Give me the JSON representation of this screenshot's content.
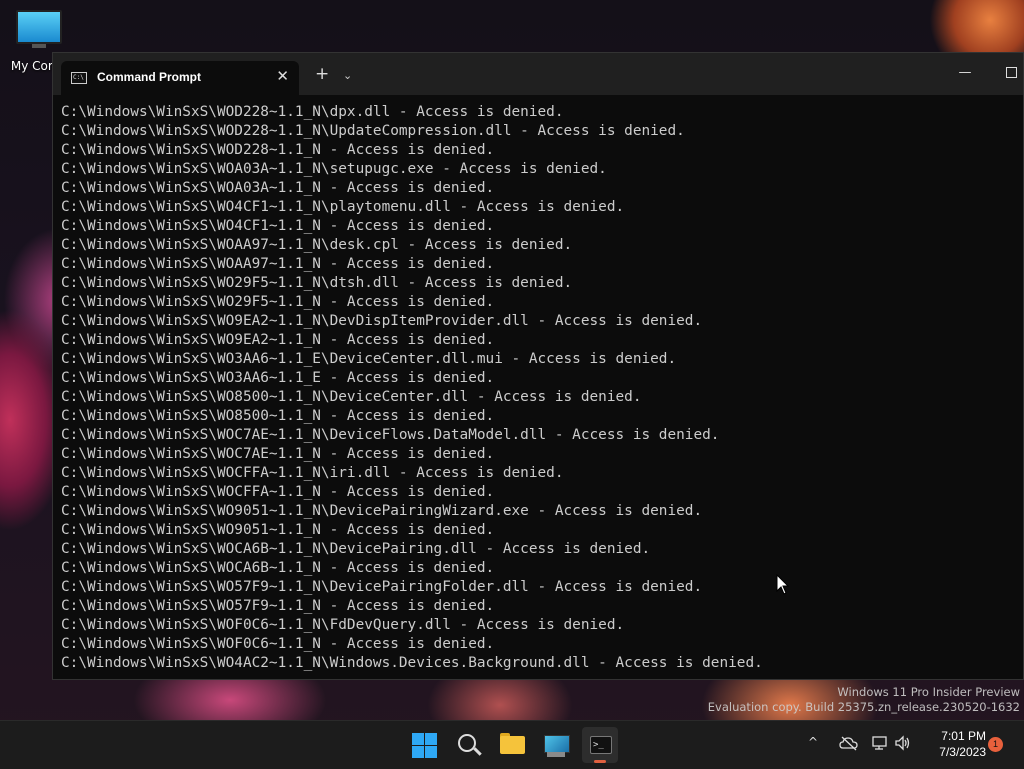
{
  "desktop": {
    "icon_label": "My Comp"
  },
  "window": {
    "tab_title": "Command Prompt",
    "tab_close": "✕",
    "new_tab": "+",
    "dropdown": "⌄",
    "minimize": "—"
  },
  "console": {
    "lines": [
      "C:\\Windows\\WinSxS\\WOD228~1.1_N\\dpx.dll - Access is denied.",
      "C:\\Windows\\WinSxS\\WOD228~1.1_N\\UpdateCompression.dll - Access is denied.",
      "C:\\Windows\\WinSxS\\WOD228~1.1_N - Access is denied.",
      "C:\\Windows\\WinSxS\\WOA03A~1.1_N\\setupugc.exe - Access is denied.",
      "C:\\Windows\\WinSxS\\WOA03A~1.1_N - Access is denied.",
      "C:\\Windows\\WinSxS\\WO4CF1~1.1_N\\playtomenu.dll - Access is denied.",
      "C:\\Windows\\WinSxS\\WO4CF1~1.1_N - Access is denied.",
      "C:\\Windows\\WinSxS\\WOAA97~1.1_N\\desk.cpl - Access is denied.",
      "C:\\Windows\\WinSxS\\WOAA97~1.1_N - Access is denied.",
      "C:\\Windows\\WinSxS\\WO29F5~1.1_N\\dtsh.dll - Access is denied.",
      "C:\\Windows\\WinSxS\\WO29F5~1.1_N - Access is denied.",
      "C:\\Windows\\WinSxS\\WO9EA2~1.1_N\\DevDispItemProvider.dll - Access is denied.",
      "C:\\Windows\\WinSxS\\WO9EA2~1.1_N - Access is denied.",
      "C:\\Windows\\WinSxS\\WO3AA6~1.1_E\\DeviceCenter.dll.mui - Access is denied.",
      "C:\\Windows\\WinSxS\\WO3AA6~1.1_E - Access is denied.",
      "C:\\Windows\\WinSxS\\WO8500~1.1_N\\DeviceCenter.dll - Access is denied.",
      "C:\\Windows\\WinSxS\\WO8500~1.1_N - Access is denied.",
      "C:\\Windows\\WinSxS\\WOC7AE~1.1_N\\DeviceFlows.DataModel.dll - Access is denied.",
      "C:\\Windows\\WinSxS\\WOC7AE~1.1_N - Access is denied.",
      "C:\\Windows\\WinSxS\\WOCFFA~1.1_N\\iri.dll - Access is denied.",
      "C:\\Windows\\WinSxS\\WOCFFA~1.1_N - Access is denied.",
      "C:\\Windows\\WinSxS\\WO9051~1.1_N\\DevicePairingWizard.exe - Access is denied.",
      "C:\\Windows\\WinSxS\\WO9051~1.1_N - Access is denied.",
      "C:\\Windows\\WinSxS\\WOCA6B~1.1_N\\DevicePairing.dll - Access is denied.",
      "C:\\Windows\\WinSxS\\WOCA6B~1.1_N - Access is denied.",
      "C:\\Windows\\WinSxS\\WO57F9~1.1_N\\DevicePairingFolder.dll - Access is denied.",
      "C:\\Windows\\WinSxS\\WO57F9~1.1_N - Access is denied.",
      "C:\\Windows\\WinSxS\\WOF0C6~1.1_N\\FdDevQuery.dll - Access is denied.",
      "C:\\Windows\\WinSxS\\WOF0C6~1.1_N - Access is denied.",
      "C:\\Windows\\WinSxS\\WO4AC2~1.1_N\\Windows.Devices.Background.dll - Access is denied."
    ]
  },
  "watermark": {
    "line1": "Windows 11 Pro Insider Preview",
    "line2": "Evaluation copy. Build 25375.zn_release.230520-1632"
  },
  "taskbar": {
    "time": "7:01 PM",
    "date": "7/3/2023",
    "notification_count": "1",
    "tray_chevron": "^"
  },
  "colors": {
    "console_bg": "#0c0c0c",
    "console_text": "#cccccc",
    "titlebar_bg": "#202020",
    "taskbar_bg": "#1c1c1c",
    "start_blue": "#2ea8f5",
    "notif_orange": "#e8603c"
  }
}
